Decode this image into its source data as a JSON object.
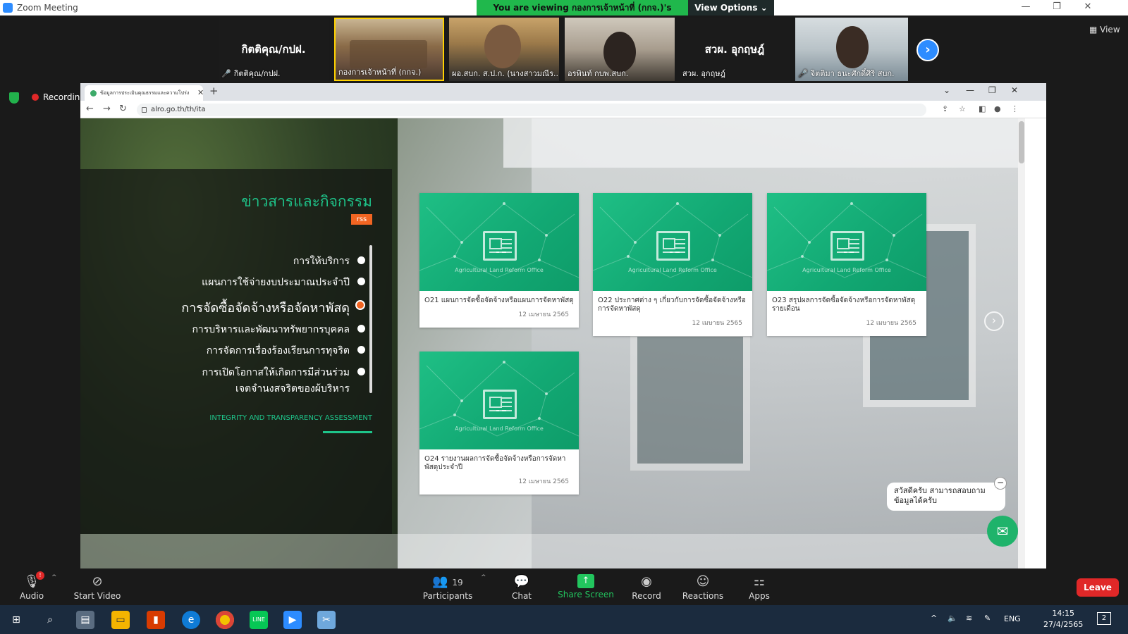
{
  "zoom": {
    "window_title": "Zoom Meeting",
    "banner": "You are viewing กองการเจ้าหน้าที่ (กกจ.)'s screen",
    "view_options": "View Options ⌄",
    "view_label": "View",
    "recording": "Recording",
    "participant_tiles": [
      {
        "big": "กิตติคุณ/กปฝ.",
        "name": "กิตติคุณ/กปฝ.",
        "muted": true
      },
      {
        "big": "",
        "name": "กองการเจ้าหน้าที่ (กกจ.)",
        "muted": false,
        "video": true,
        "active": true
      },
      {
        "big": "",
        "name": "ผอ.สบก. ส.ป.ก. (นางสาวมณีร...",
        "muted": false,
        "video": true
      },
      {
        "big": "",
        "name": "อรพินท์ กบพ.สบก.",
        "muted": false,
        "video": true
      },
      {
        "big": "สวผ. อุกฤษฎ์",
        "name": "สวผ. อุกฤษฎ์",
        "muted": false
      },
      {
        "big": "",
        "name": "จิตติมา ธนะศักดิ์ศิริ สบก.",
        "muted": true,
        "video": true
      }
    ],
    "toolbar": {
      "audio": "Audio",
      "audio_badge": "!",
      "start_video": "Start Video",
      "participants": "Participants",
      "participants_count": "19",
      "chat": "Chat",
      "share_screen": "Share Screen",
      "record": "Record",
      "reactions": "Reactions",
      "apps": "Apps",
      "leave": "Leave"
    }
  },
  "browser": {
    "tab_title": "ข้อมูลการประเมินคุณธรรมและความโปร่ง",
    "url": "alro.go.th/th/ita"
  },
  "site": {
    "section_title": "ข่าวสารและกิจกรรม",
    "rss": "rss",
    "menu": [
      {
        "label": "การให้บริการ",
        "active": false
      },
      {
        "label": "แผนการใช้จ่ายงบประมาณประจำปี",
        "active": false
      },
      {
        "label": "การจัดซื้อจัดจ้างหรือจัดหาพัสดุ",
        "active": true
      },
      {
        "label": "การบริหารและพัฒนาทรัพยากรบุคคล",
        "active": false
      },
      {
        "label": "การจัดการเรื่องร้องเรียนการทุจริต",
        "active": false
      },
      {
        "label": "การเปิดโอกาสให้เกิดการมีส่วนร่วม",
        "active": false
      },
      {
        "label": "เจตจำนงสุจริตของผู้บริหาร",
        "active": false
      }
    ],
    "ita_label": "INTEGRITY AND TRANSPARENCY ASSESSMENT",
    "card_org": "Agricultural Land Reform Office",
    "cards": [
      {
        "title": "O21 แผนการจัดซื้อจัดจ้างหรือแผนการจัดหาพัสดุ",
        "date": "12 เมษายน 2565"
      },
      {
        "title": "O22 ประกาศต่าง ๆ เกี่ยวกับการจัดซื้อจัดจ้างหรือการจัดหาพัสดุ",
        "date": "12 เมษายน 2565"
      },
      {
        "title": "O23 สรุปผลการจัดซื้อจัดจ้างหรือการจัดหาพัสดุรายเดือน",
        "date": "12 เมษายน 2565"
      },
      {
        "title": "O24 รายงานผลการจัดซื้อจัดจ้างหรือการจัดหาพัสดุประจำปี",
        "date": "12 เมษายน 2565"
      }
    ],
    "chat_bubble": "สวัสดีครับ สามารถสอบถามข้อมูลได้ครับ"
  },
  "taskbar": {
    "lang": "ENG",
    "time": "14:15",
    "date": "27/4/2565",
    "notifications": "2"
  },
  "colors": {
    "accent_green": "#1ec48a",
    "zoom_blue": "#2d8cff",
    "leave_red": "#e02828",
    "rss_orange": "#f26522"
  }
}
